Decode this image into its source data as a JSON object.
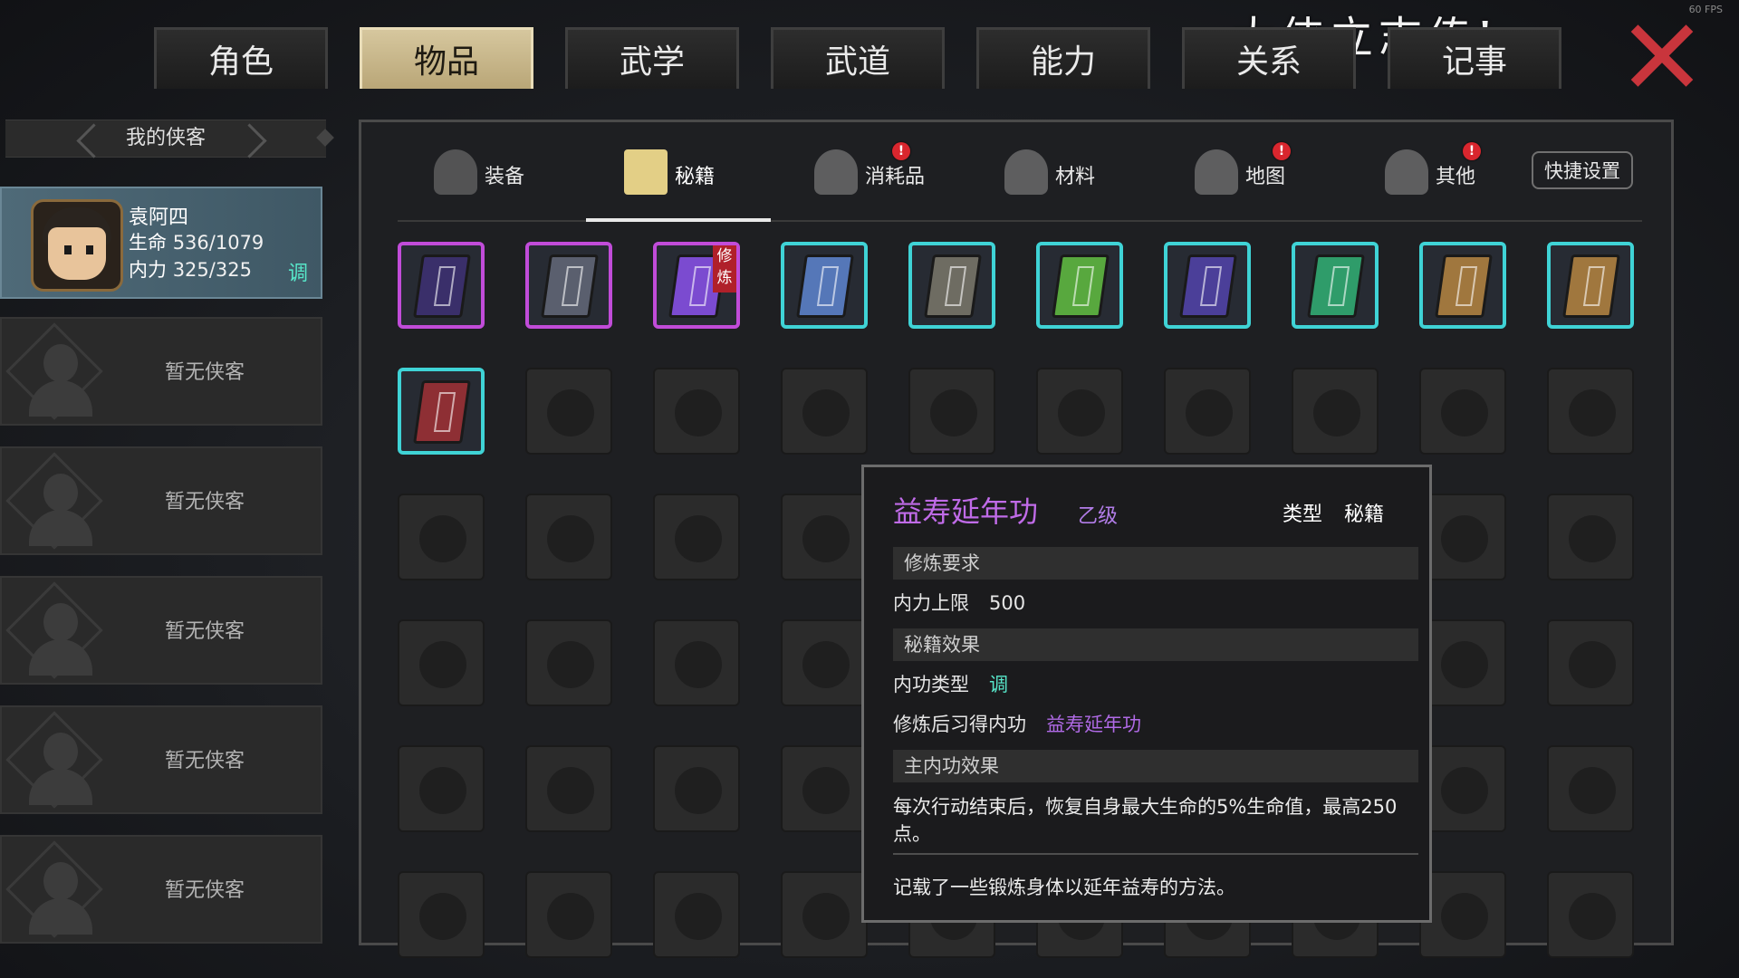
{
  "fps": "60 FPS",
  "game_title": "大侠立志传!",
  "top_tabs": [
    {
      "label": "角色",
      "badge": true,
      "active": false
    },
    {
      "label": "物品",
      "badge": true,
      "active": true
    },
    {
      "label": "武学",
      "badge": false,
      "active": false
    },
    {
      "label": "武道",
      "badge": false,
      "active": false
    },
    {
      "label": "能力",
      "badge": false,
      "active": false
    },
    {
      "label": "关系",
      "badge": false,
      "active": false
    },
    {
      "label": "记事",
      "badge": false,
      "active": false
    }
  ],
  "badge_symbol": "!",
  "party": {
    "header": "我的侠客",
    "character": {
      "name": "袁阿四",
      "hp_label": "生命",
      "hp": "536/1079",
      "mp_label": "内力",
      "mp": "325/325",
      "type": "调"
    },
    "empty_label": "暂无侠客",
    "empty_count": 5
  },
  "sub_tabs": [
    {
      "label": "装备",
      "icon": "armor-icon",
      "badge": false
    },
    {
      "label": "秘籍",
      "icon": "book-icon",
      "badge": false,
      "active": true
    },
    {
      "label": "消耗品",
      "icon": "potion-icon",
      "badge": true
    },
    {
      "label": "材料",
      "icon": "herb-icon",
      "badge": false
    },
    {
      "label": "地图",
      "icon": "map-icon",
      "badge": true
    },
    {
      "label": "其他",
      "icon": "misc-icon",
      "badge": true
    }
  ],
  "quick_settings": "快捷设置",
  "items": [
    {
      "color": "#3a2f6a",
      "rarity": "purple",
      "tag": ""
    },
    {
      "color": "#5a5f6e",
      "rarity": "purple",
      "tag": ""
    },
    {
      "color": "#7b4bd0",
      "rarity": "purple",
      "tag": "修炼"
    },
    {
      "color": "#5577b8",
      "rarity": "cyan",
      "tag": ""
    },
    {
      "color": "#6e6c62",
      "rarity": "cyan",
      "tag": ""
    },
    {
      "color": "#58a83e",
      "rarity": "cyan",
      "tag": ""
    },
    {
      "color": "#4b3f99",
      "rarity": "cyan",
      "tag": ""
    },
    {
      "color": "#2f9c6a",
      "rarity": "cyan",
      "tag": ""
    },
    {
      "color": "#a0773e",
      "rarity": "cyan",
      "tag": ""
    },
    {
      "color": "#a0773e",
      "rarity": "cyan",
      "tag": ""
    },
    {
      "color": "#8e2f34",
      "rarity": "cyan",
      "tag": ""
    }
  ],
  "tooltip": {
    "name": "益寿延年功",
    "grade": "乙级",
    "type_label": "类型",
    "type_value": "秘籍",
    "section_req": "修炼要求",
    "req_label": "内力上限",
    "req_value": "500",
    "section_effect": "秘籍效果",
    "effect_type_label": "内功类型",
    "effect_type_value": "调",
    "learn_label": "修炼后习得内功",
    "learn_value": "益寿延年功",
    "section_main": "主内功效果",
    "main_effect": "每次行动结束后，恢复自身最大生命的5%生命值，最高250点。",
    "lore": "记载了一些锻炼身体以延年益寿的方法。"
  }
}
